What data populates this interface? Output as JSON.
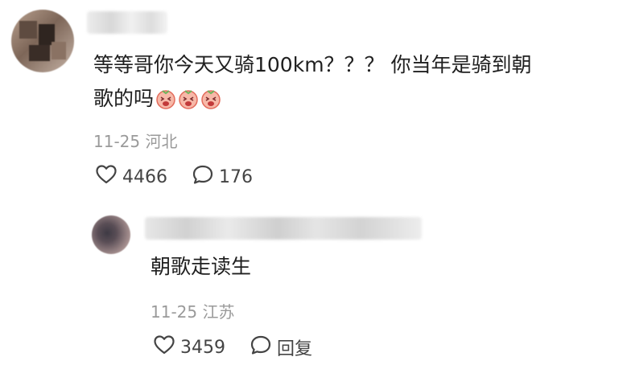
{
  "comment": {
    "text_line1": "等等哥你今天又骑100km？？？ 你当年是骑到朝",
    "text_line2": "歌的吗",
    "emoji_icons": [
      "crying-face-emoji",
      "crying-face-emoji",
      "crying-face-emoji"
    ],
    "date": "11-25",
    "location": "河北",
    "likes": "4466",
    "replies": "176"
  },
  "reply": {
    "text": "朝歌走读生",
    "date": "11-25",
    "location": "江苏",
    "likes": "3459",
    "reply_label": "回复"
  },
  "colors": {
    "text": "#1f1f1f",
    "meta": "#9a9a9a",
    "icon": "#444444",
    "emoji_face": "#f6b2a4"
  }
}
